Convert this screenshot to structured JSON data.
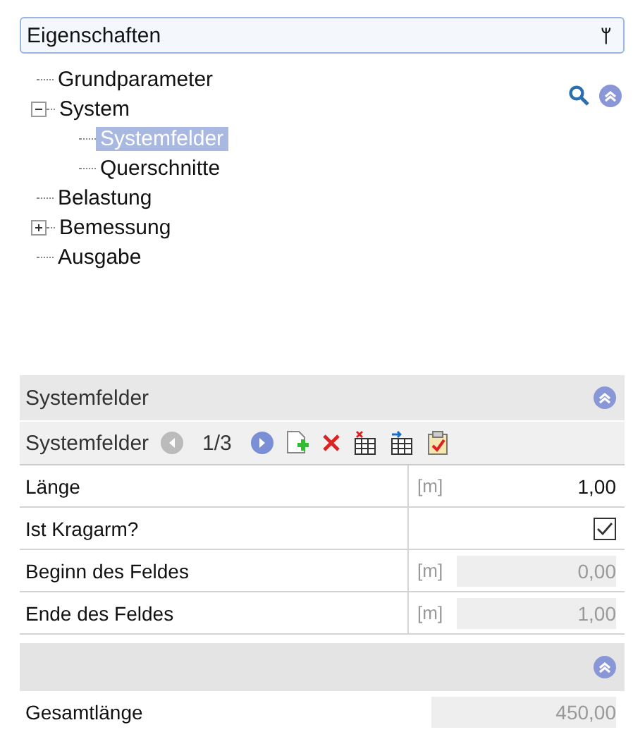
{
  "panel": {
    "title": "Eigenschaften",
    "pin": "ᛘ"
  },
  "tree": [
    {
      "label": "Grundparameter",
      "selected": false
    },
    {
      "label": "System",
      "selected": false,
      "expanded": true,
      "children": [
        {
          "label": "Systemfelder",
          "selected": true
        },
        {
          "label": "Querschnitte",
          "selected": false
        }
      ]
    },
    {
      "label": "Belastung",
      "selected": false
    },
    {
      "label": "Bemessung",
      "selected": false,
      "expanded": false
    },
    {
      "label": "Ausgabe",
      "selected": false
    }
  ],
  "section": {
    "title": "Systemfelder"
  },
  "toolbar": {
    "label": "Systemfelder",
    "counter": "1/3"
  },
  "rows": [
    {
      "kind": "number",
      "label": "Länge",
      "unit": "[m]",
      "value": "1,00",
      "disabled": false
    },
    {
      "kind": "checkbox",
      "label": "Ist Kragarm?",
      "checked": true
    },
    {
      "kind": "number",
      "label": "Beginn des Feldes",
      "unit": "[m]",
      "value": "0,00",
      "disabled": true
    },
    {
      "kind": "number",
      "label": "Ende des Feldes",
      "unit": "[m]",
      "value": "1,00",
      "disabled": true
    }
  ],
  "summary": {
    "label": "Gesamtlänge",
    "value": "450,00",
    "disabled": true
  }
}
